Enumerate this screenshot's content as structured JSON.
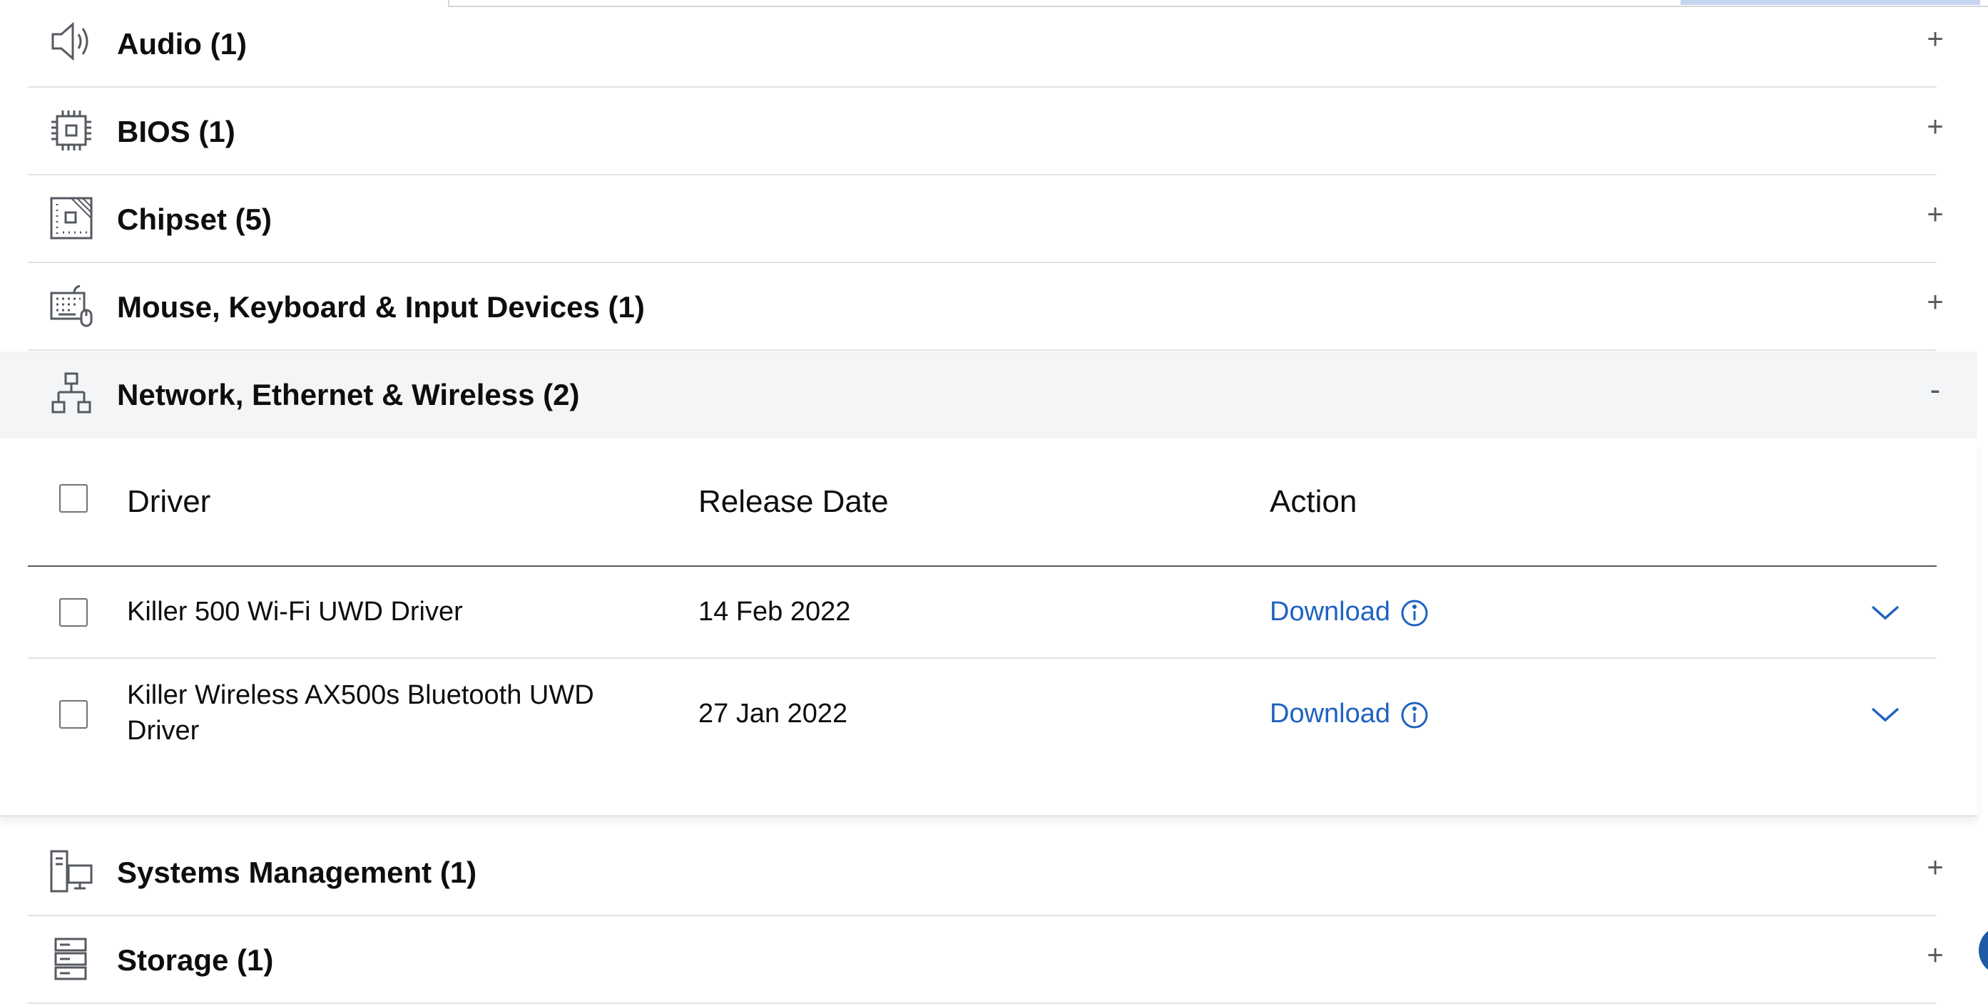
{
  "categories": [
    {
      "label": "Audio (1)",
      "icon": "speaker-icon",
      "toggle": "+"
    },
    {
      "label": "BIOS (1)",
      "icon": "chip-icon",
      "toggle": "+"
    },
    {
      "label": "Chipset (5)",
      "icon": "chipset-icon",
      "toggle": "+"
    },
    {
      "label": "Mouse, Keyboard & Input Devices (1)",
      "icon": "keyboard-mouse-icon",
      "toggle": "+"
    },
    {
      "label": "Network, Ethernet & Wireless (2)",
      "icon": "network-icon",
      "toggle": "-"
    },
    {
      "label": "Systems Management (1)",
      "icon": "computer-icon",
      "toggle": "+"
    },
    {
      "label": "Storage (1)",
      "icon": "storage-icon",
      "toggle": "+"
    }
  ],
  "table": {
    "headers": {
      "driver": "Driver",
      "release_date": "Release Date",
      "action": "Action"
    },
    "rows": [
      {
        "driver": "Killer 500 Wi-Fi UWD Driver",
        "date": "14 Feb 2022",
        "action": "Download"
      },
      {
        "driver": "Killer Wireless AX500s Bluetooth UWD Driver",
        "date": "27 Jan 2022",
        "action": "Download"
      }
    ]
  },
  "colors": {
    "link": "#1f63c0",
    "expanded_bg": "#f4f5f6",
    "text": "#0e0e0e"
  }
}
